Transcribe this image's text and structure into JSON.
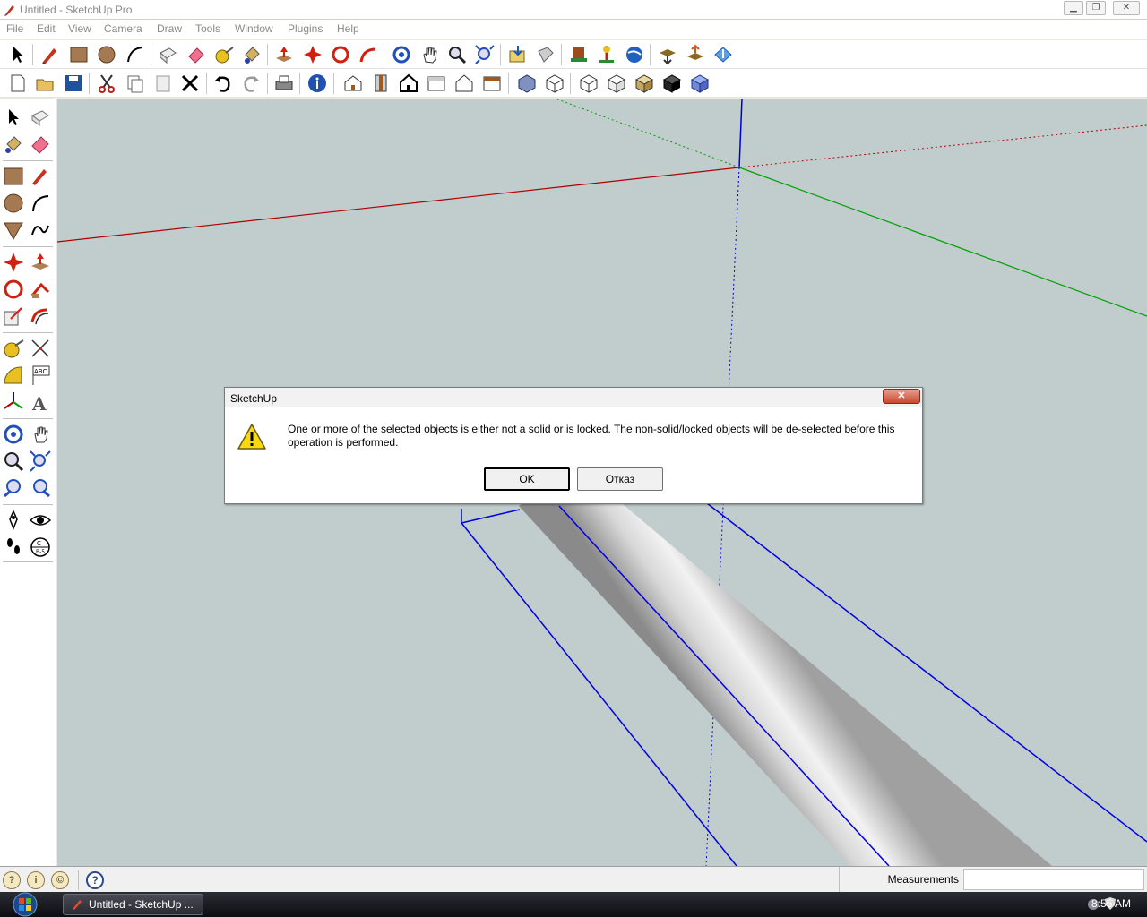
{
  "window": {
    "title": "Untitled - SketchUp Pro",
    "controls": {
      "minimize": "▁",
      "restore": "❐",
      "close": "✕"
    }
  },
  "menu": {
    "items": [
      "File",
      "Edit",
      "View",
      "Camera",
      "Draw",
      "Tools",
      "Window",
      "Plugins",
      "Help"
    ]
  },
  "dialog": {
    "title": "SketchUp",
    "close_label": "✕",
    "message": "One or more of the selected objects is either not a solid or is locked. The non-solid/locked objects will be de-selected before this operation is performed.",
    "ok_label": "OK",
    "cancel_label": "Отказ",
    "icon": "warning-icon"
  },
  "statusbar": {
    "icons": [
      "geo-location-icon",
      "credits-icon",
      "user-icon"
    ],
    "icon_glyphs": [
      "?",
      "i",
      "©"
    ],
    "help_glyph": "?",
    "measurements_label": "Measurements",
    "measurements_value": ""
  },
  "taskbar": {
    "task_label": "Untitled - SketchUp ...",
    "clock": "8:55 AM"
  },
  "colors": {
    "viewport_bg": "#c1cccd",
    "axis_red": "#b00000",
    "axis_green": "#00a000",
    "axis_blue": "#0000d0",
    "selection_blue": "#0000e0"
  }
}
